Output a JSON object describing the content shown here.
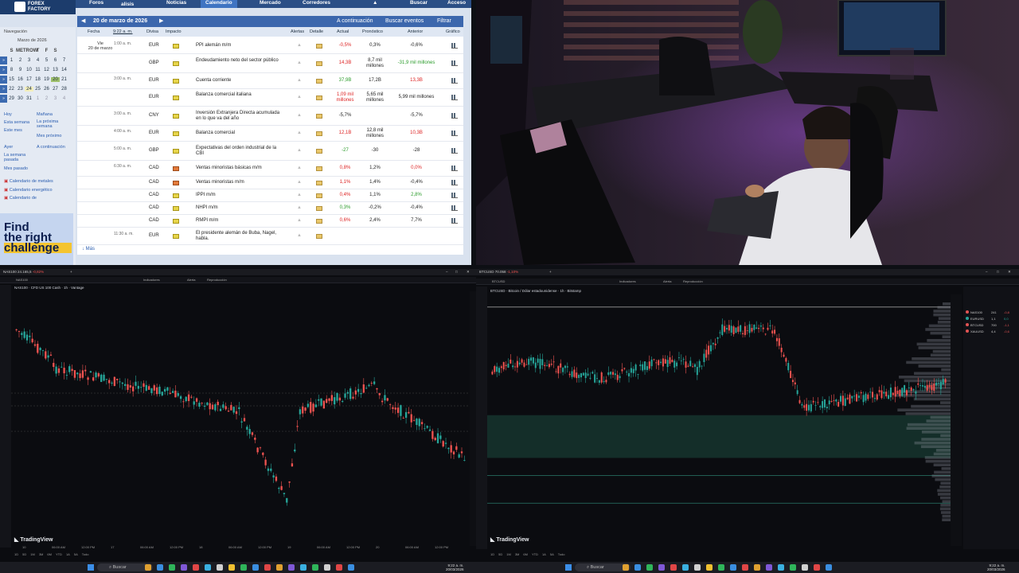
{
  "forexfactory": {
    "logo_line1": "FOREX",
    "logo_line2": "FACTORY",
    "nav": [
      "Foros",
      "alisis",
      "Noticias",
      "Calendario",
      "Mercado",
      "Corredores",
      "Buscar",
      "Acceso"
    ],
    "date_title": "20 de marzo de 2026",
    "up_next": "A continuación",
    "search_events": "Buscar eventos",
    "filter": "Filtrar",
    "headers": {
      "fecha": "Fecha",
      "time": "9:22 a. m.",
      "divisa": "Divisa",
      "impacto": "Impacto",
      "alertas": "Alertas",
      "detalle": "Detalle",
      "actual": "Actual",
      "pronostico": "Pronóstico",
      "anterior": "Anterior",
      "grafico": "Gráfico"
    },
    "day_label": "Vie\n20 de marzo",
    "events": [
      {
        "time": "1:00 a. m.",
        "currency": "EUR",
        "impact": "yellow",
        "event": "PPI alemán m/m",
        "actual": "-0,5%",
        "actual_color": "red",
        "forecast": "0,3%",
        "previous": "-0,6%",
        "previous_color": ""
      },
      {
        "time": "",
        "currency": "GBP",
        "impact": "yellow",
        "event": "Endeudamiento neto del sector público",
        "actual": "14,3B",
        "actual_color": "red",
        "forecast": "8,7 mil millones",
        "previous": "-31,9 mil millones",
        "previous_color": "green"
      },
      {
        "time": "3:00 a. m.",
        "currency": "EUR",
        "impact": "yellow",
        "event": "Cuenta corriente",
        "actual": "37,9B",
        "actual_color": "green",
        "forecast": "17,2B",
        "previous": "13,3B",
        "previous_color": "red"
      },
      {
        "time": "",
        "currency": "EUR",
        "impact": "yellow",
        "event": "Balanza comercial italiana",
        "actual": "1,09 mil millones",
        "actual_color": "red",
        "forecast": "5,65 mil millones",
        "previous": "5,99 mil millones",
        "previous_color": ""
      },
      {
        "time": "3:00 a. m.",
        "currency": "CNY",
        "impact": "yellow",
        "event": "Inversión Extranjera Directa acumulada en lo que va del año",
        "actual": "-5,7%",
        "actual_color": "",
        "forecast": "",
        "previous": "-5,7%",
        "previous_color": ""
      },
      {
        "time": "4:00 a. m.",
        "currency": "EUR",
        "impact": "yellow",
        "event": "Balanza comercial",
        "actual": "12,1B",
        "actual_color": "red",
        "forecast": "12,8 mil millones",
        "previous": "10,3B",
        "previous_color": "red"
      },
      {
        "time": "5:00 a. m.",
        "currency": "GBP",
        "impact": "yellow",
        "event": "Expectativas del orden industrial de la CBI",
        "actual": "-27",
        "actual_color": "green",
        "forecast": "-30",
        "previous": "-28",
        "previous_color": ""
      },
      {
        "time": "6:30 a. m.",
        "currency": "CAD",
        "impact": "orange",
        "event": "Ventas minoristas básicas m/m",
        "actual": "0,8%",
        "actual_color": "red",
        "forecast": "1,2%",
        "previous": "0,0%",
        "previous_color": "red"
      },
      {
        "time": "",
        "currency": "CAD",
        "impact": "orange",
        "event": "Ventas minoristas m/m",
        "actual": "1,1%",
        "actual_color": "red",
        "forecast": "1,4%",
        "previous": "-0,4%",
        "previous_color": ""
      },
      {
        "time": "",
        "currency": "CAD",
        "impact": "yellow",
        "event": "IPPI m/m",
        "actual": "0,4%",
        "actual_color": "red",
        "forecast": "1,1%",
        "previous": "2,8%",
        "previous_color": "green"
      },
      {
        "time": "",
        "currency": "CAD",
        "impact": "yellow",
        "event": "NHPI m/m",
        "actual": "0,3%",
        "actual_color": "green",
        "forecast": "-0,2%",
        "previous": "-0,4%",
        "previous_color": ""
      },
      {
        "time": "",
        "currency": "CAD",
        "impact": "yellow",
        "event": "RMPI m/m",
        "actual": "0,6%",
        "actual_color": "red",
        "forecast": "2,4%",
        "previous": "7,7%",
        "previous_color": ""
      },
      {
        "time": "11:30 a. m.",
        "currency": "EUR",
        "impact": "yellow",
        "event": "El presidente alemán de Buba, Nagel, habla.",
        "actual": "",
        "actual_color": "",
        "forecast": "",
        "previous": "",
        "previous_color": ""
      }
    ],
    "more": "Más",
    "sidebar": {
      "nav_title": "Navegación",
      "month": "Marzo de 2026",
      "weekdays": [
        "S",
        "METROW",
        "T",
        "F",
        "S"
      ],
      "weeks": [
        [
          "1",
          "2",
          "3",
          "4",
          "5",
          "6",
          "7"
        ],
        [
          "8",
          "9",
          "10",
          "11",
          "12",
          "13",
          "14"
        ],
        [
          "15",
          "16",
          "17",
          "18",
          "19",
          "20",
          "21"
        ],
        [
          "22",
          "23",
          "24",
          "25",
          "26",
          "27",
          "28"
        ],
        [
          "29",
          "30",
          "31",
          "1",
          "2",
          "3",
          "4"
        ]
      ],
      "links": [
        "Hoy",
        "Mañana",
        "Esta semana",
        "La próxima semana",
        "Este mes",
        "Mes próximo",
        "Ayer",
        "A continuación",
        "La semana pasada",
        "Mes pasado",
        "Calendario de metales",
        "Calendario energético",
        "Calendario de"
      ],
      "ad_line1": "Find",
      "ad_line2": "the right",
      "ad_line3": "challenge"
    }
  },
  "tv_left": {
    "tab": "NAS100",
    "price_tab": "24.165,5",
    "change": "-0,82%",
    "indicators": "Indicadores",
    "alerts": "Alerta",
    "replay": "Reproducción",
    "symbol_line": "NAS100 · CFD US 100 Cash · 1h · Vantage",
    "logo": "TradingView",
    "x_labels": [
      "10",
      "06:00 AM",
      "12:00 PM",
      "17",
      "06:00 AM",
      "12:00 PM",
      "18",
      "06:00 AM",
      "12:00 PM",
      "19",
      "06:00 AM",
      "12:00 PM",
      "20",
      "06:00 AM",
      "12:00 PM"
    ],
    "footer": [
      "1D",
      "5D",
      "1M",
      "3M",
      "6M",
      "YTD",
      "1A",
      "5A",
      "Todo"
    ]
  },
  "tv_right": {
    "tab": "BTCUSD",
    "price_tab": "70.058",
    "change": "-1,10%",
    "indicators": "Indicadores",
    "alerts": "Alerta",
    "replay": "Reproducción",
    "symbol_line": "BTCUSD · Bitcoin / Dólar estadounidense · 1h · Bitstamp",
    "logo": "TradingView",
    "watchlist": [
      {
        "sym": "NAS100",
        "last": "241",
        "chg": "-0,8",
        "color": "#e25353"
      },
      {
        "sym": "EURUSD",
        "last": "1,1",
        "chg": "0,0",
        "color": "#26a69a"
      },
      {
        "sym": "BTCUSD",
        "last": "700",
        "chg": "-1,1",
        "color": "#e25353"
      },
      {
        "sym": "XAUUSD",
        "last": "4,4",
        "chg": "-0,6",
        "color": "#e25353"
      }
    ],
    "footer": [
      "1D",
      "5D",
      "1M",
      "3M",
      "6M",
      "YTD",
      "1A",
      "5A",
      "Todo"
    ]
  },
  "taskbar": {
    "search_left": "Buscar",
    "search_right": "Buscar",
    "time_left": "9:22 a. m.",
    "date_left": "20/03/2026",
    "time_right": "9:22 a. m.",
    "date_right": "20/03/2026"
  },
  "colors": {
    "up": "#26a69a",
    "down": "#ef5350",
    "ff_blue": "#2b4f86",
    "tv_bg": "#0b0c10"
  }
}
